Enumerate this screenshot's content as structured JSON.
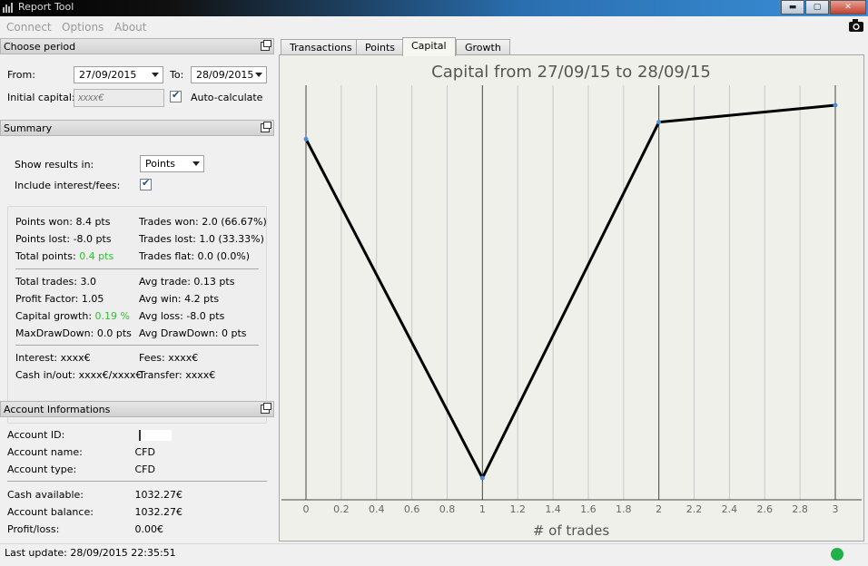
{
  "window": {
    "title": "Report Tool",
    "minimize": "▬",
    "maximize": "▢",
    "close": "✕"
  },
  "menu": [
    "Connect",
    "Options",
    "About"
  ],
  "period": {
    "header": "Choose period",
    "from_label": "From:",
    "from_value": "27/09/2015",
    "to_label": "To:",
    "to_value": "28/09/2015",
    "initial_capital_label": "Initial capital:",
    "initial_capital_placeholder": "xxxx€",
    "auto_calc_label": "Auto-calculate"
  },
  "summary": {
    "header": "Summary",
    "show_results_label": "Show results in:",
    "show_results_value": "Points",
    "include_interest_label": "Include interest/fees:",
    "left1": [
      {
        "label": "Points won:",
        "value": "8.4 pts"
      },
      {
        "label": "Points lost:",
        "value": "-8.0 pts"
      },
      {
        "label": "Total points:",
        "value": "0.4 pts"
      }
    ],
    "right1": [
      {
        "label": "Trades won:",
        "value": "2.0 (66.67%)"
      },
      {
        "label": "Trades lost:",
        "value": "1.0 (33.33%)"
      },
      {
        "label": "Trades flat:",
        "value": "0.0 (0.0%)"
      }
    ],
    "left2": [
      {
        "label": "Total trades:",
        "value": "3.0"
      },
      {
        "label": "Profit Factor:",
        "value": "1.05"
      },
      {
        "label": "Capital growth:",
        "value": "0.19 %"
      },
      {
        "label": "MaxDrawDown:",
        "value": "0.0 pts"
      }
    ],
    "right2": [
      {
        "label": "Avg trade:",
        "value": "0.13 pts"
      },
      {
        "label": "Avg win:",
        "value": "4.2 pts"
      },
      {
        "label": "Avg loss:",
        "value": "-8.0 pts"
      },
      {
        "label": "Avg DrawDown:",
        "value": "0 pts"
      }
    ],
    "left3": [
      {
        "label": "Interest:",
        "value": "xxxx€"
      },
      {
        "label": "Cash in/out:",
        "value": "xxxx€/xxxx€"
      }
    ],
    "right3": [
      {
        "label": "Fees:",
        "value": "xxxx€"
      },
      {
        "label": "Transfer:",
        "value": "xxxx€"
      }
    ]
  },
  "account": {
    "header": "Account Informations",
    "rows1": [
      {
        "label": "Account ID:",
        "value": ""
      },
      {
        "label": "Account name:",
        "value": "CFD"
      },
      {
        "label": "Account type:",
        "value": "CFD"
      }
    ],
    "rows2": [
      {
        "label": "Cash available:",
        "value": "1032.27€"
      },
      {
        "label": "Account balance:",
        "value": "1032.27€"
      },
      {
        "label": "Profit/loss:",
        "value": "0.00€"
      }
    ]
  },
  "tabs": [
    "Transactions",
    "Points",
    "Capital",
    "Growth"
  ],
  "active_tab": "Capital",
  "status": {
    "last_update": "Last update: 28/09/2015 22:35:51",
    "connection_color": "#21b14b"
  },
  "chart_data": {
    "type": "line",
    "title": "Capital from 27/09/15 to 28/09/15",
    "xlabel": "# of trades",
    "ylabel": "",
    "x": [
      0,
      1,
      2,
      3
    ],
    "y": [
      1032.08,
      1030.08,
      1032.18,
      1032.28
    ],
    "xlim": [
      0,
      3
    ],
    "xticks": [
      0,
      0.2,
      0.4,
      0.6,
      0.8,
      1,
      1.2,
      1.4,
      1.6,
      1.8,
      2,
      2.2,
      2.4,
      2.6,
      2.8,
      3
    ],
    "ylim": [
      1030.08,
      1032.28
    ],
    "grid": true,
    "line_color": "#000000",
    "point_color": "#4a90d9"
  }
}
